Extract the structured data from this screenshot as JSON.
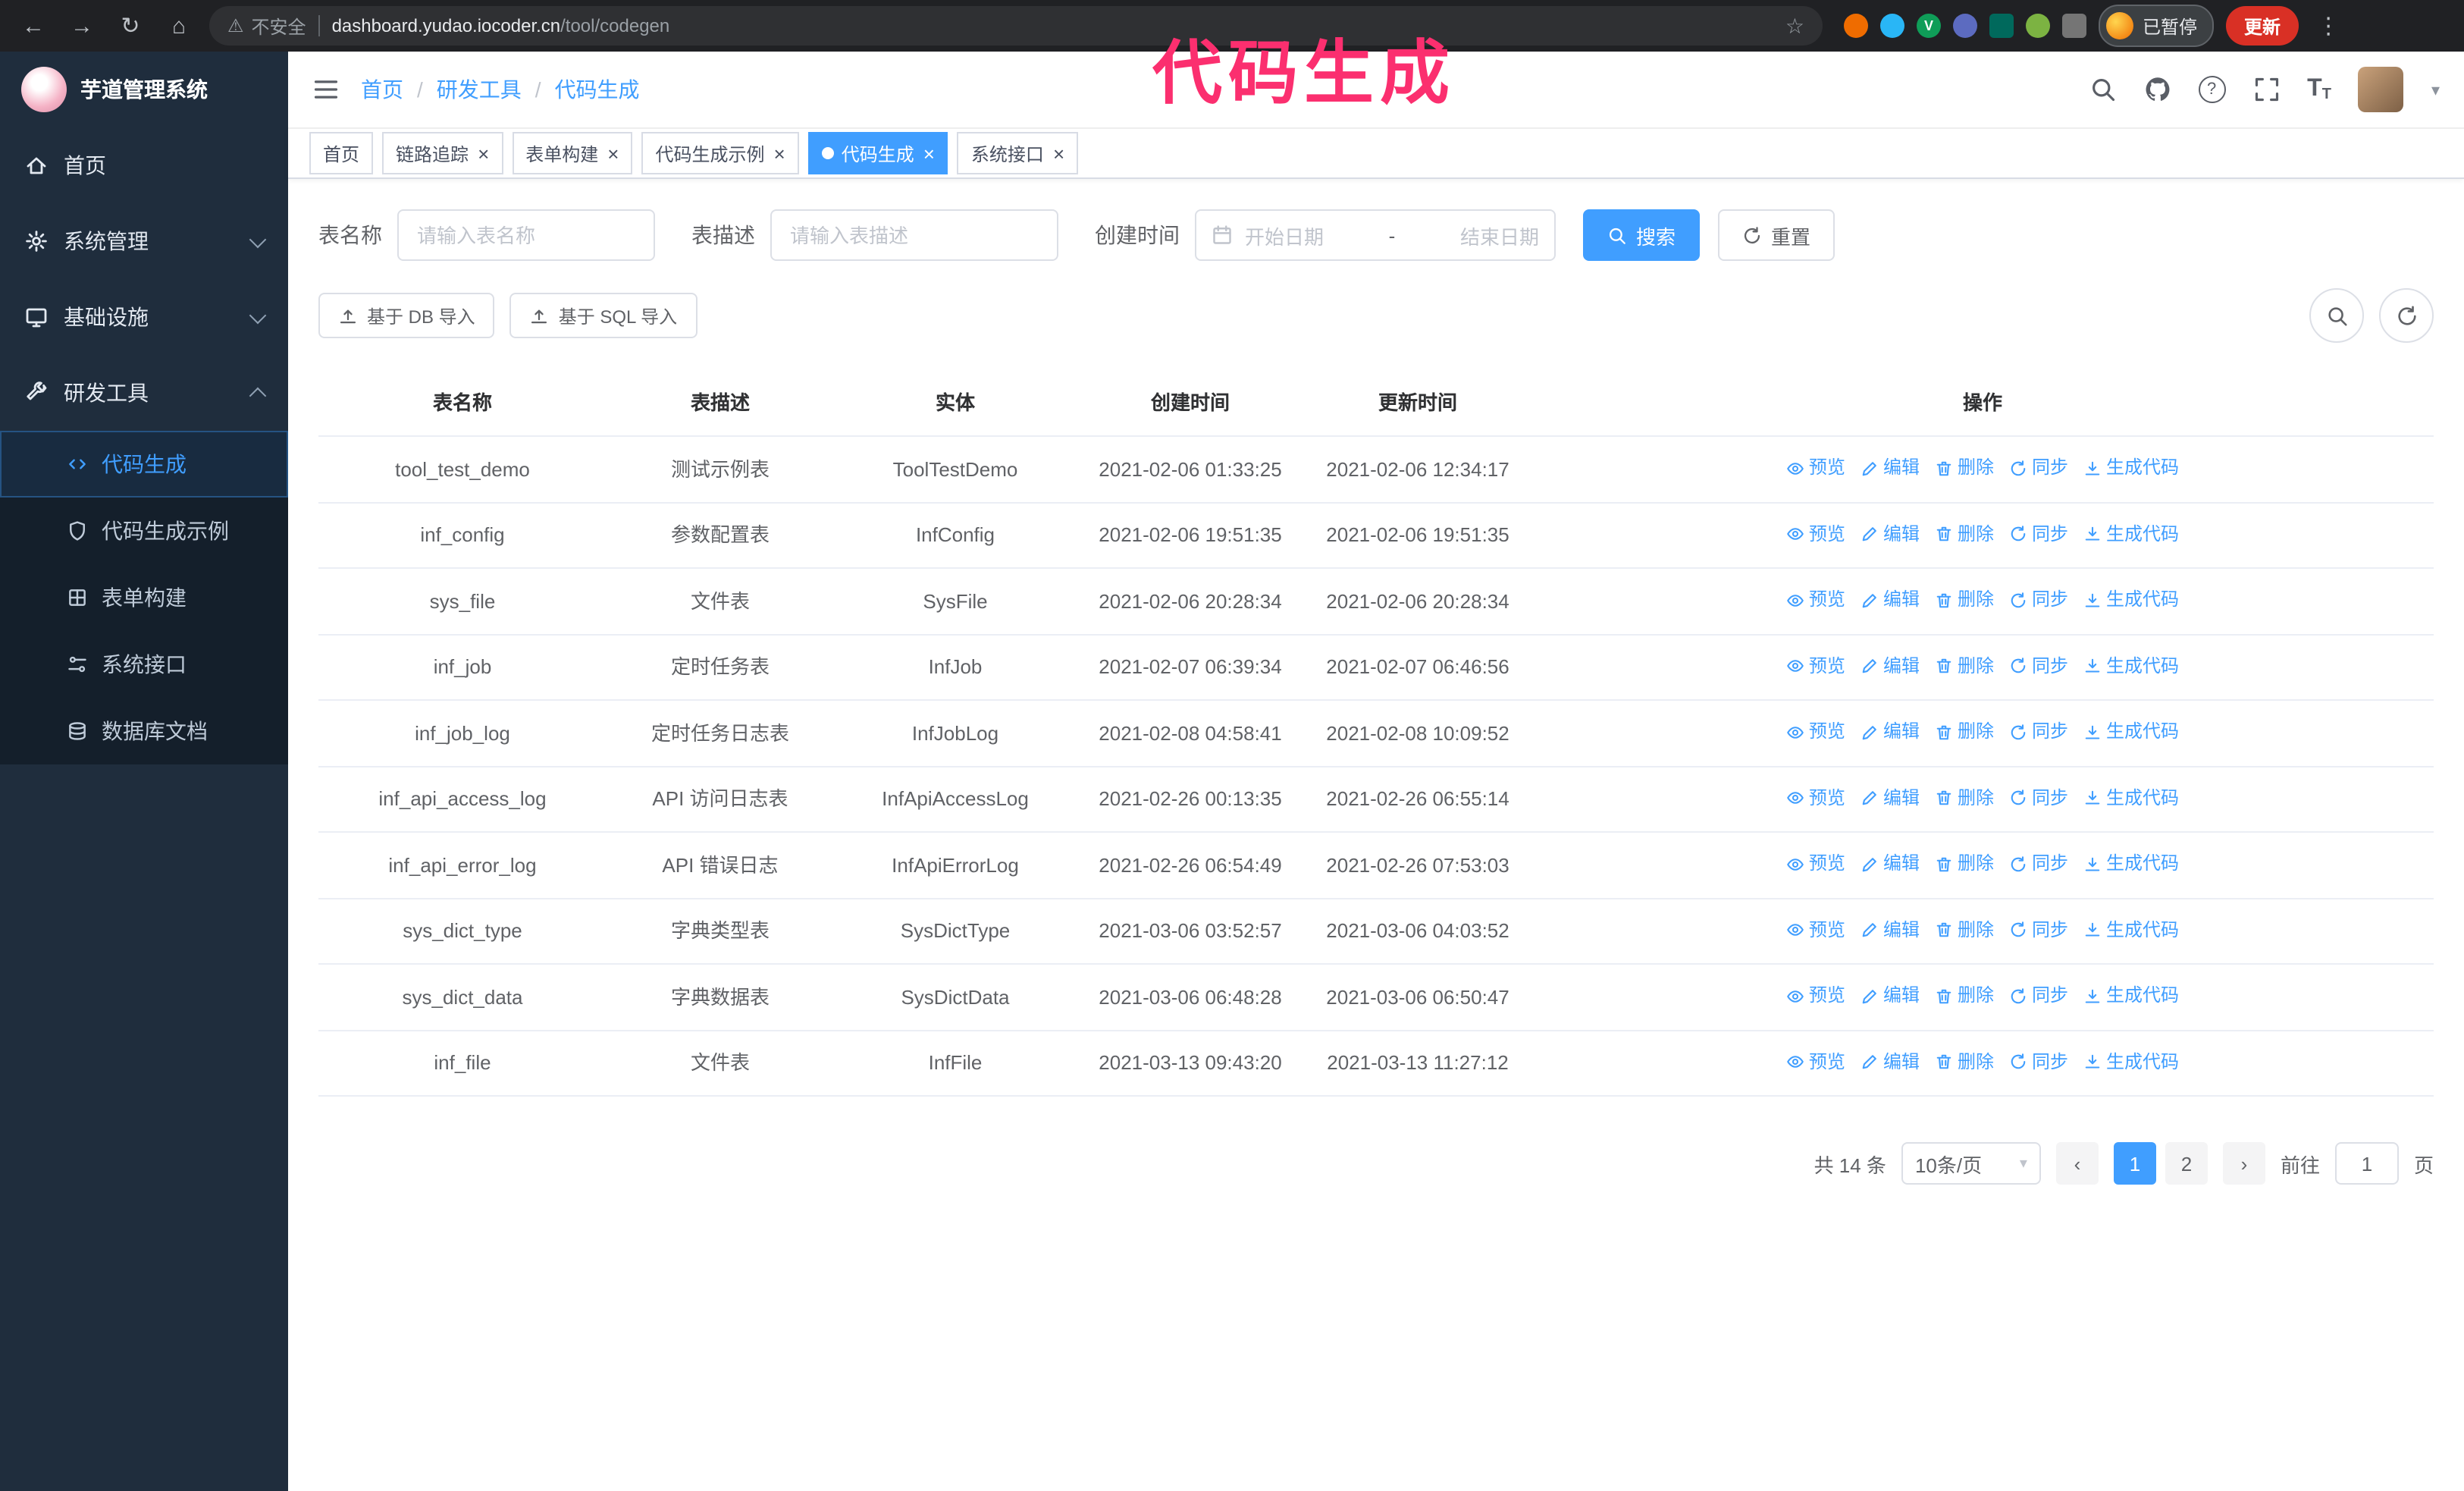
{
  "colors": {
    "accent": "#409eff",
    "annotation": "#fb2f6f",
    "update_button_bg": "#d93025",
    "sidebar_bg": "#1f2d3d"
  },
  "annotation": {
    "text": "代码生成"
  },
  "browser": {
    "security_warning": "不安全",
    "url_host": "dashboard.yudao.iocoder.cn",
    "url_path": "/tool/codegen",
    "paused_badge": "已暂停",
    "update_button": "更新"
  },
  "sidebar": {
    "logo_title": "芋道管理系统",
    "items": [
      {
        "label": "首页",
        "icon": "home-icon"
      },
      {
        "label": "系统管理",
        "icon": "gear-icon"
      },
      {
        "label": "基础设施",
        "icon": "monitor-icon"
      },
      {
        "label": "研发工具",
        "icon": "tools-icon",
        "children": [
          {
            "label": "代码生成",
            "icon": "code-icon",
            "active": true
          },
          {
            "label": "代码生成示例",
            "icon": "shield-icon"
          },
          {
            "label": "表单构建",
            "icon": "grid-icon"
          },
          {
            "label": "系统接口",
            "icon": "api-icon"
          },
          {
            "label": "数据库文档",
            "icon": "database-icon"
          }
        ]
      }
    ]
  },
  "header": {
    "breadcrumb": [
      "首页",
      "研发工具",
      "代码生成"
    ]
  },
  "tabs": [
    {
      "label": "首页",
      "closable": false,
      "active": false
    },
    {
      "label": "链路追踪",
      "closable": true,
      "active": false
    },
    {
      "label": "表单构建",
      "closable": true,
      "active": false
    },
    {
      "label": "代码生成示例",
      "closable": true,
      "active": false
    },
    {
      "label": "代码生成",
      "closable": true,
      "active": true
    },
    {
      "label": "系统接口",
      "closable": true,
      "active": false
    }
  ],
  "filters": {
    "table_name_label": "表名称",
    "table_name_placeholder": "请输入表名称",
    "table_desc_label": "表描述",
    "table_desc_placeholder": "请输入表描述",
    "create_time_label": "创建时间",
    "date_start_placeholder": "开始日期",
    "date_separator": "-",
    "date_end_placeholder": "结束日期",
    "search_button": "搜索",
    "reset_button": "重置"
  },
  "toolbar": {
    "import_db_button": "基于 DB 导入",
    "import_sql_button": "基于 SQL 导入"
  },
  "table": {
    "columns": [
      "表名称",
      "表描述",
      "实体",
      "创建时间",
      "更新时间",
      "操作"
    ],
    "actions": [
      {
        "label": "预览",
        "icon": "eye-icon"
      },
      {
        "label": "编辑",
        "icon": "edit-icon"
      },
      {
        "label": "删除",
        "icon": "delete-icon"
      },
      {
        "label": "同步",
        "icon": "sync-icon"
      },
      {
        "label": "生成代码",
        "icon": "code-download-icon"
      }
    ],
    "rows": [
      {
        "name": "tool_test_demo",
        "desc": "测试示例表",
        "entity": "ToolTestDemo",
        "created": "2021-02-06 01:33:25",
        "updated": "2021-02-06 12:34:17"
      },
      {
        "name": "inf_config",
        "desc": "参数配置表",
        "entity": "InfConfig",
        "created": "2021-02-06 19:51:35",
        "updated": "2021-02-06 19:51:35"
      },
      {
        "name": "sys_file",
        "desc": "文件表",
        "entity": "SysFile",
        "created": "2021-02-06 20:28:34",
        "updated": "2021-02-06 20:28:34"
      },
      {
        "name": "inf_job",
        "desc": "定时任务表",
        "entity": "InfJob",
        "created": "2021-02-07 06:39:34",
        "updated": "2021-02-07 06:46:56"
      },
      {
        "name": "inf_job_log",
        "desc": "定时任务日志表",
        "entity": "InfJobLog",
        "created": "2021-02-08 04:58:41",
        "updated": "2021-02-08 10:09:52"
      },
      {
        "name": "inf_api_access_log",
        "desc": "API 访问日志表",
        "entity": "InfApiAccessLog",
        "created": "2021-02-26 00:13:35",
        "updated": "2021-02-26 06:55:14"
      },
      {
        "name": "inf_api_error_log",
        "desc": "API 错误日志",
        "entity": "InfApiErrorLog",
        "created": "2021-02-26 06:54:49",
        "updated": "2021-02-26 07:53:03"
      },
      {
        "name": "sys_dict_type",
        "desc": "字典类型表",
        "entity": "SysDictType",
        "created": "2021-03-06 03:52:57",
        "updated": "2021-03-06 04:03:52"
      },
      {
        "name": "sys_dict_data",
        "desc": "字典数据表",
        "entity": "SysDictData",
        "created": "2021-03-06 06:48:28",
        "updated": "2021-03-06 06:50:47"
      },
      {
        "name": "inf_file",
        "desc": "文件表",
        "entity": "InfFile",
        "created": "2021-03-13 09:43:20",
        "updated": "2021-03-13 11:27:12"
      }
    ]
  },
  "pagination": {
    "total_text": "共 14 条",
    "page_size": "10条/页",
    "pages": [
      "1",
      "2"
    ],
    "active_page": "1",
    "goto_label": "前往",
    "goto_value": "1",
    "goto_suffix": "页"
  }
}
